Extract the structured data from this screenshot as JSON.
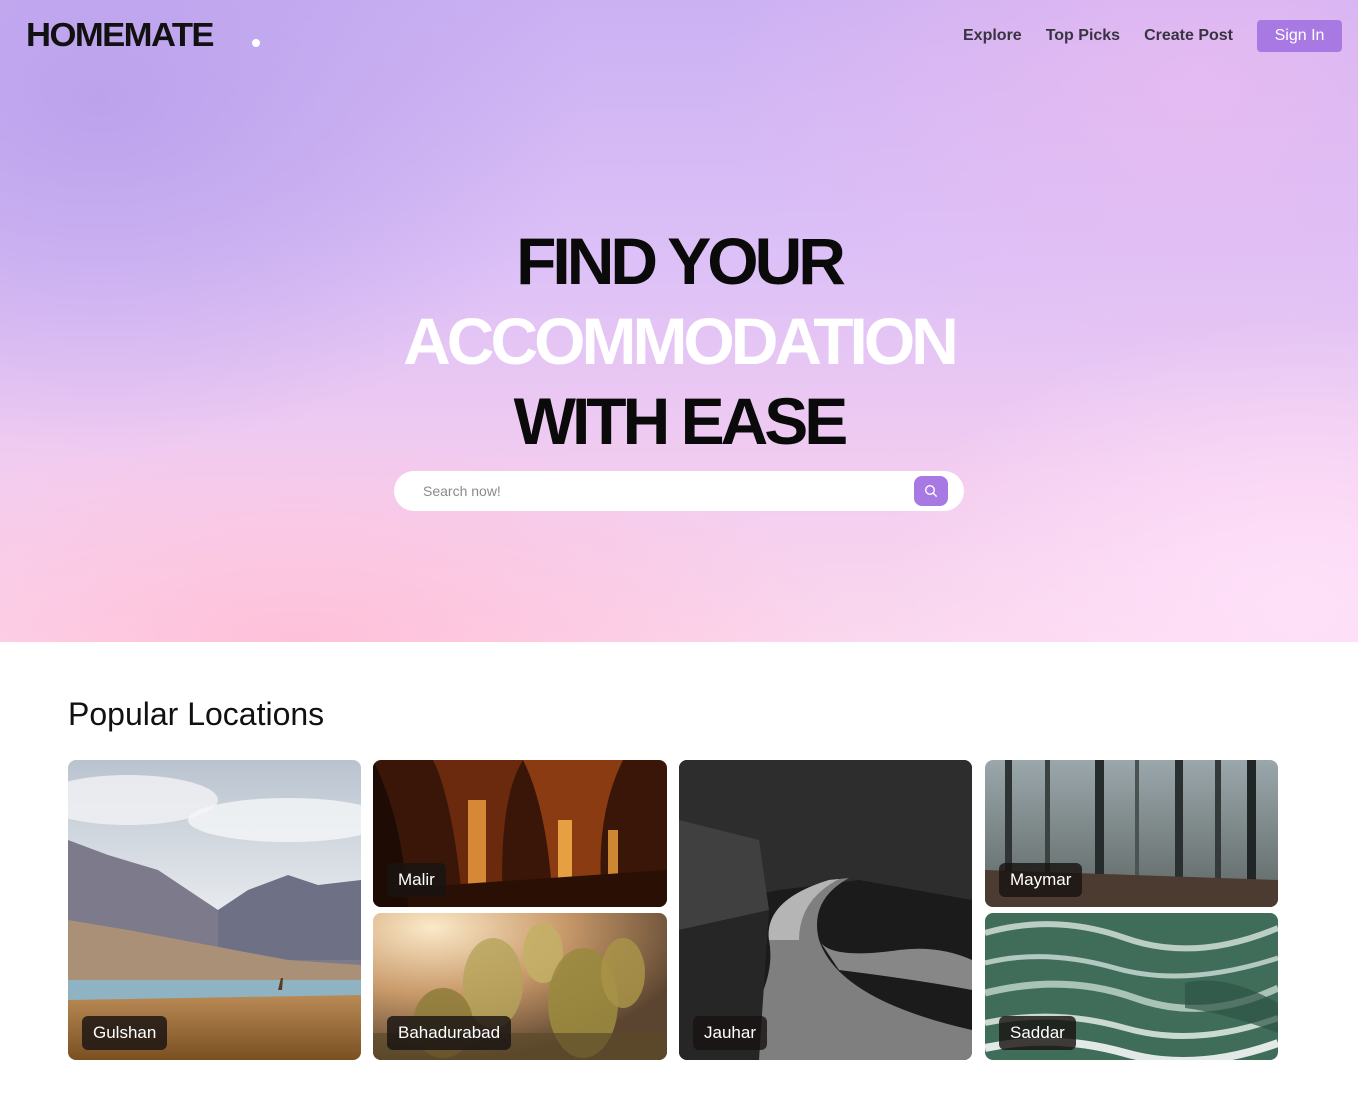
{
  "header": {
    "logo": "HOMEMATE",
    "nav": [
      "Explore",
      "Top Picks",
      "Create Post"
    ],
    "sign_in": "Sign In"
  },
  "hero": {
    "line1": "FIND YOUR",
    "line2": "ACCOMMODATION",
    "line3": "WITH EASE",
    "search": {
      "placeholder": "Search now!",
      "value": ""
    }
  },
  "popular": {
    "title": "Popular Locations",
    "locations": [
      "Gulshan",
      "Malir",
      "Bahadurabad",
      "Jauhar",
      "Maymar",
      "Saddar"
    ]
  },
  "colors": {
    "accent": "#a879e3",
    "tag_bg": "#181412"
  }
}
